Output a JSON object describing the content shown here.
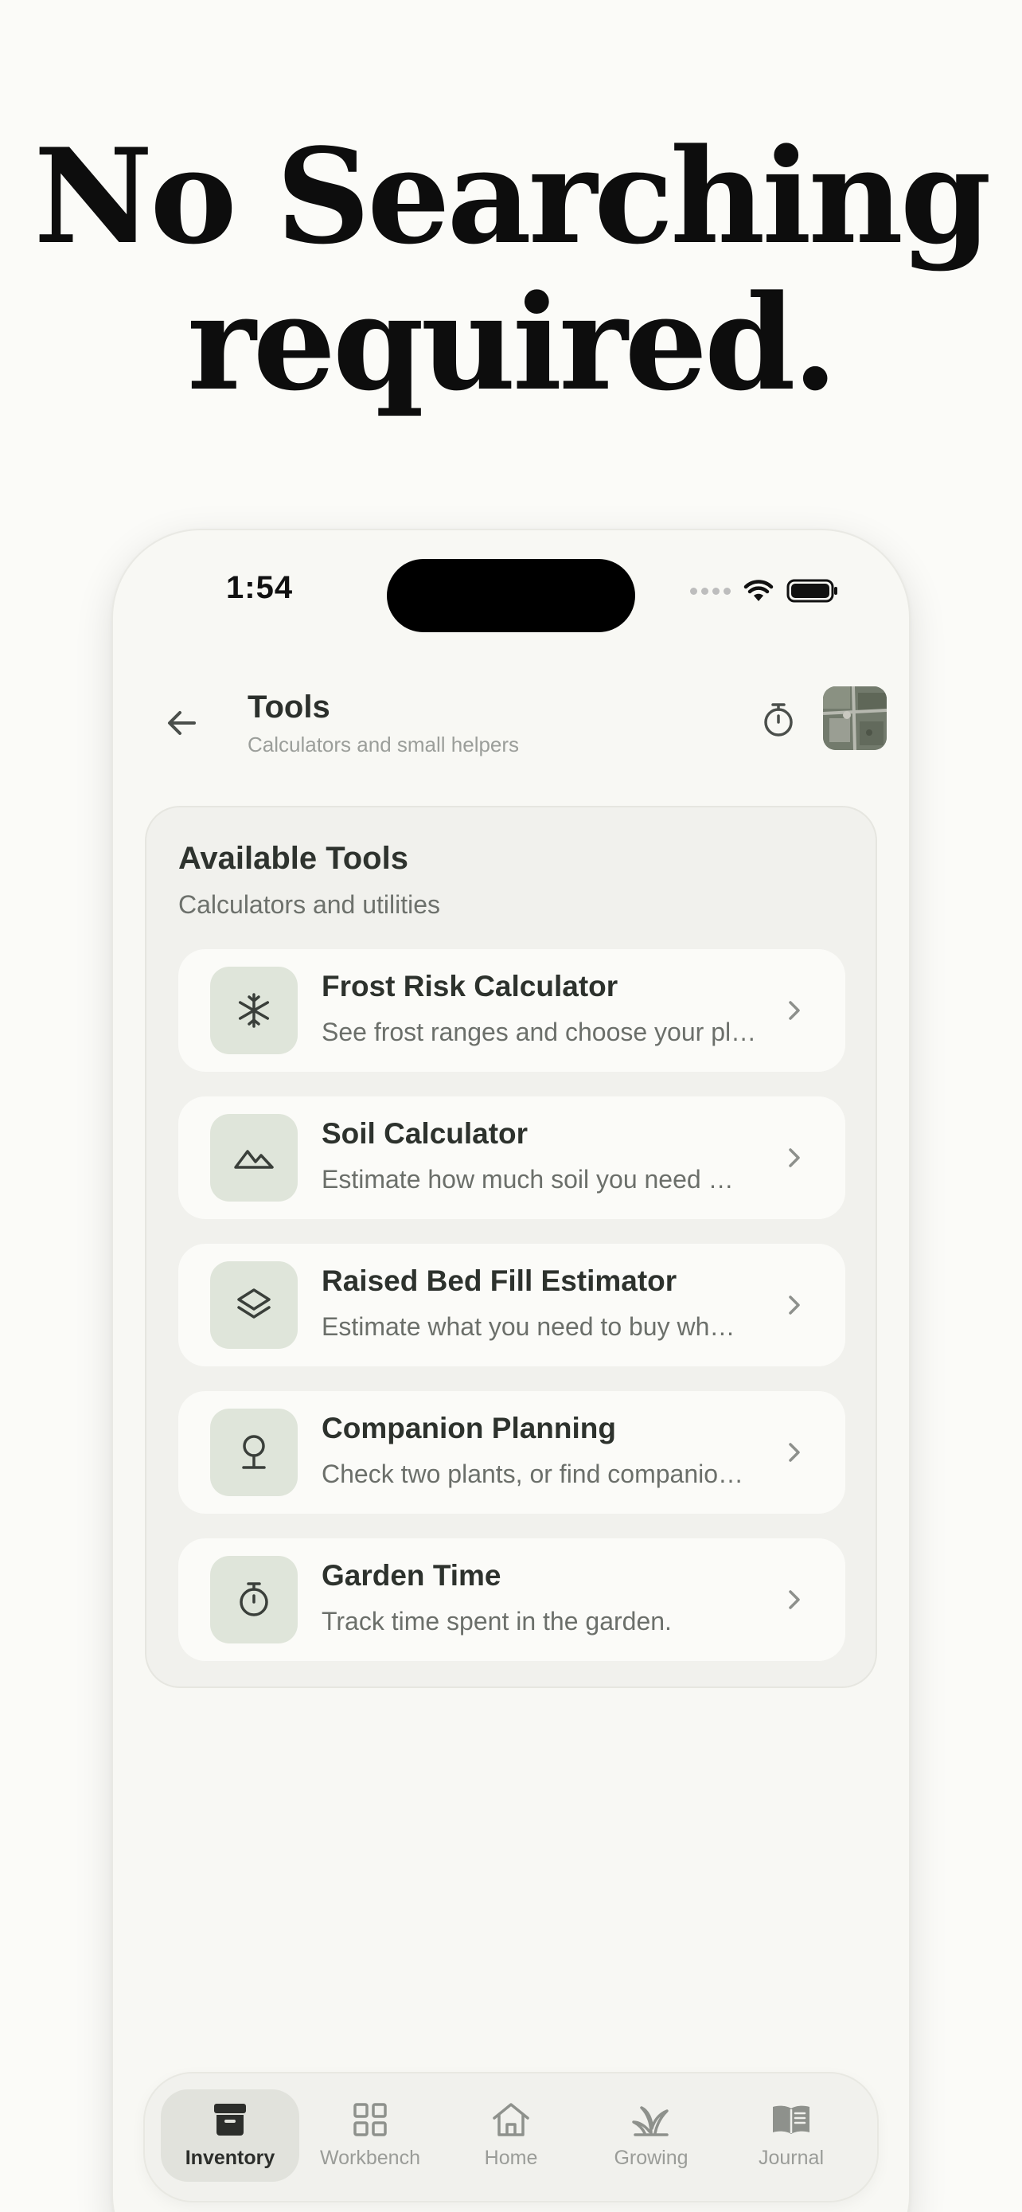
{
  "headline": {
    "line1": "No Searching",
    "line2": "required."
  },
  "status_bar": {
    "time": "1:54"
  },
  "header": {
    "title": "Tools",
    "subtitle": "Calculators and small helpers",
    "back_icon": "arrow-left-icon",
    "timer_icon": "stopwatch-icon",
    "avatar_icon": "satellite-map-avatar"
  },
  "tools_card": {
    "title": "Available Tools",
    "subtitle": "Calculators and utilities",
    "items": [
      {
        "name": "Frost Risk Calculator",
        "description": "See frost ranges and choose your pl…",
        "icon": "snowflake-icon"
      },
      {
        "name": "Soil Calculator",
        "description": "Estimate how much soil you need …",
        "icon": "mountains-icon"
      },
      {
        "name": "Raised Bed Fill Estimator",
        "description": "Estimate what you need to buy wh…",
        "icon": "layers-icon"
      },
      {
        "name": "Companion Planning",
        "description": "Check two plants, or find companio…",
        "icon": "tree-icon"
      },
      {
        "name": "Garden Time",
        "description": "Track time spent in the garden.",
        "icon": "stopwatch-icon"
      }
    ]
  },
  "tab_bar": {
    "active": "Inventory",
    "tabs": [
      {
        "label": "Inventory",
        "icon": "archive-box-icon"
      },
      {
        "label": "Workbench",
        "icon": "grid-icon"
      },
      {
        "label": "Home",
        "icon": "house-icon"
      },
      {
        "label": "Growing",
        "icon": "sprout-icon"
      },
      {
        "label": "Journal",
        "icon": "open-book-icon"
      }
    ]
  },
  "colors": {
    "background": "#fbfbf8",
    "card": "#f1f1ed",
    "icon_tile": "#dfe5da",
    "text_primary": "#2d322d",
    "text_secondary": "#6b6f6a"
  }
}
